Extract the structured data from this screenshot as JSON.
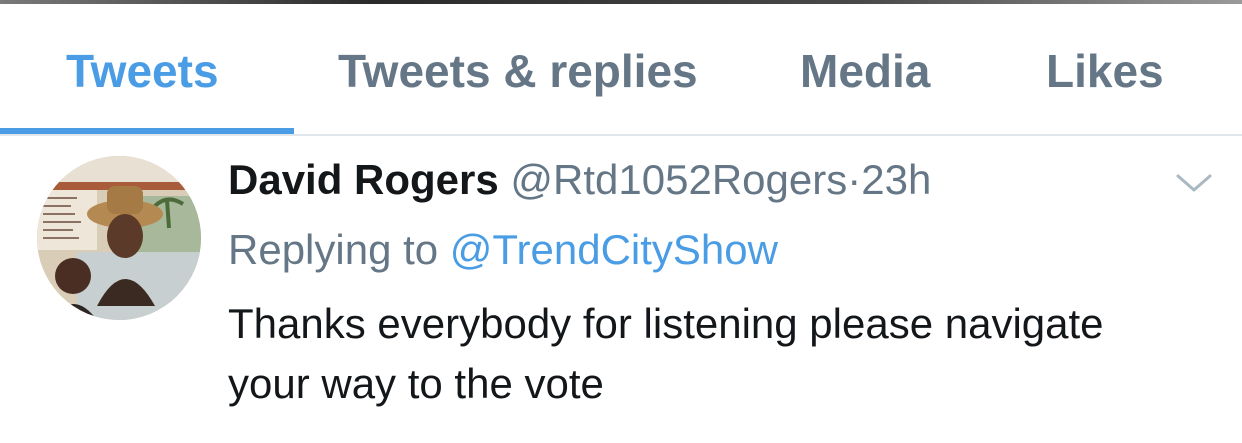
{
  "tabs": [
    {
      "label": "Tweets",
      "active": true
    },
    {
      "label": "Tweets & replies",
      "active": false
    },
    {
      "label": "Media",
      "active": false
    },
    {
      "label": "Likes",
      "active": false
    }
  ],
  "tweet": {
    "author_name": "David Rogers",
    "author_handle": "@Rtd1052Rogers",
    "separator": "·",
    "timestamp": "23h",
    "replying_prefix": "Replying to ",
    "replying_to": "@TrendCityShow",
    "text": "Thanks everybody for listening please navigate your way to the vote",
    "avatar_icon": "profile-photo-collage",
    "menu_icon": "chevron-down-icon"
  },
  "colors": {
    "accent": "#4a9de4",
    "secondary_text": "#657786",
    "primary_text": "#14171a",
    "divider": "#e1e8ed"
  }
}
